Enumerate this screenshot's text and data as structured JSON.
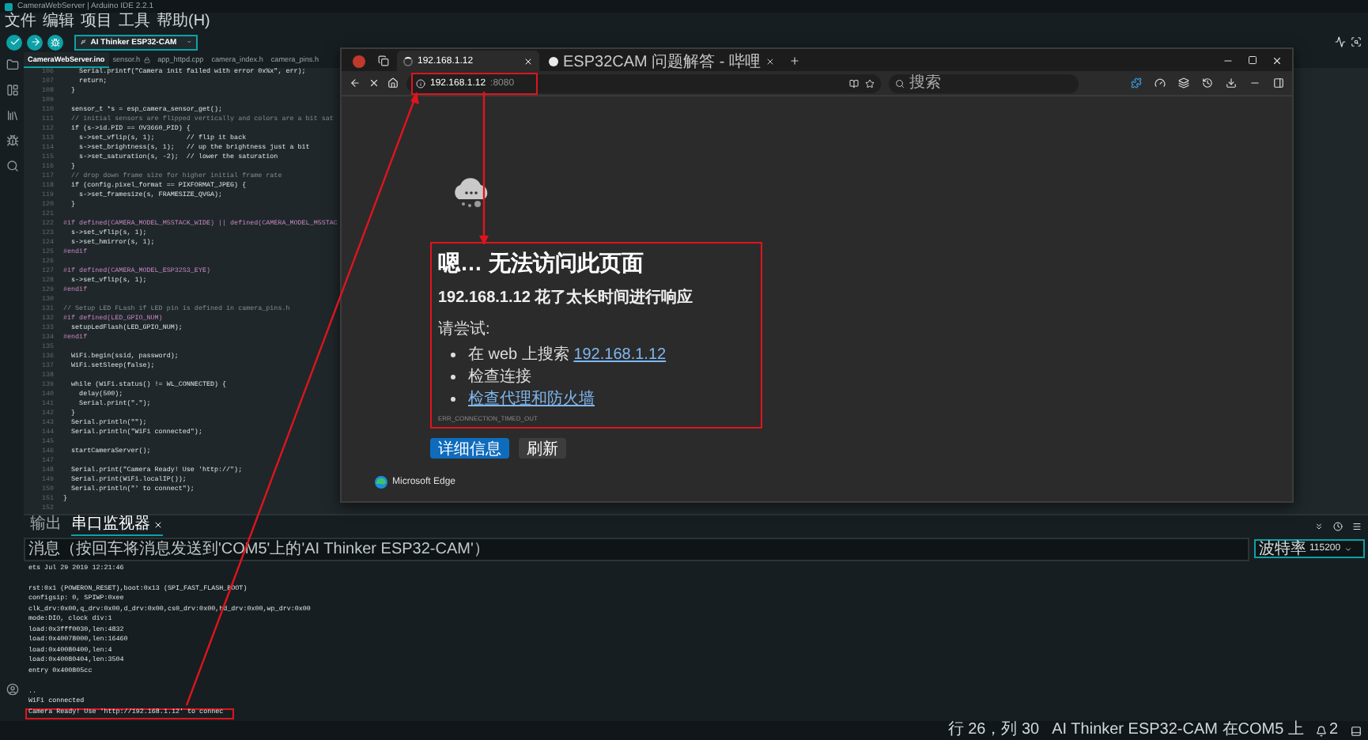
{
  "ide": {
    "title": "CameraWebServer | Arduino IDE 2.2.1",
    "menu": [
      "文件",
      "编辑",
      "项目",
      "工具",
      "帮助(H)"
    ],
    "board": "AI Thinker ESP32-CAM",
    "file_tabs": [
      {
        "label": "CameraWebServer.ino",
        "selected": true,
        "locked": false
      },
      {
        "label": "sensor.h",
        "selected": false,
        "locked": true
      },
      {
        "label": "app_httpd.cpp",
        "selected": false,
        "locked": false
      },
      {
        "label": "camera_index.h",
        "selected": false,
        "locked": false
      },
      {
        "label": "camera_pins.h",
        "selected": false,
        "locked": false
      }
    ],
    "code_lines": [
      {
        "number": "106",
        "kind": "code",
        "text": "    Serial.printf(\"Camera init failed with error 0x%x\", err);"
      },
      {
        "number": "107",
        "kind": "code",
        "text": "    return;"
      },
      {
        "number": "108",
        "kind": "code",
        "text": "  }"
      },
      {
        "number": "109"
      },
      {
        "number": "110",
        "kind": "code",
        "text": "  sensor_t *s = esp_camera_sensor_get();"
      },
      {
        "number": "111",
        "kind": "comment",
        "text": "  // initial sensors are flipped vertically and colors are a bit sat"
      },
      {
        "number": "112",
        "kind": "code",
        "text": "  if (s->id.PID == OV3660_PID) {"
      },
      {
        "number": "113",
        "kind": "code",
        "text": "    s->set_vflip(s, 1);        // flip it back"
      },
      {
        "number": "114",
        "kind": "code",
        "text": "    s->set_brightness(s, 1);   // up the brightness just a bit"
      },
      {
        "number": "115",
        "kind": "code",
        "text": "    s->set_saturation(s, -2);  // lower the saturation"
      },
      {
        "number": "116",
        "kind": "code",
        "text": "  }"
      },
      {
        "number": "117",
        "kind": "comment",
        "text": "  // drop down frame size for higher initial frame rate"
      },
      {
        "number": "118",
        "kind": "code",
        "text": "  if (config.pixel_format == PIXFORMAT_JPEG) {"
      },
      {
        "number": "119",
        "kind": "code",
        "text": "    s->set_framesize(s, FRAMESIZE_QVGA);"
      },
      {
        "number": "120",
        "kind": "code",
        "text": "  }"
      },
      {
        "number": "121"
      },
      {
        "number": "122",
        "kind": "directive",
        "text": "#if defined(CAMERA_MODEL_M5STACK_WIDE) || defined(CAMERA_MODEL_M5STAC"
      },
      {
        "number": "123",
        "kind": "code",
        "text": "  s->set_vflip(s, 1);"
      },
      {
        "number": "124",
        "kind": "code",
        "text": "  s->set_hmirror(s, 1);"
      },
      {
        "number": "125",
        "kind": "directive",
        "text": "#endif"
      },
      {
        "number": "126"
      },
      {
        "number": "127",
        "kind": "directive",
        "text": "#if defined(CAMERA_MODEL_ESP32S3_EYE)"
      },
      {
        "number": "128",
        "kind": "code",
        "text": "  s->set_vflip(s, 1);"
      },
      {
        "number": "129",
        "kind": "directive",
        "text": "#endif"
      },
      {
        "number": "130"
      },
      {
        "number": "131",
        "kind": "comment",
        "text": "// Setup LED FLash if LED pin is defined in camera_pins.h"
      },
      {
        "number": "132",
        "kind": "directive",
        "text": "#if defined(LED_GPIO_NUM)"
      },
      {
        "number": "133",
        "kind": "code",
        "text": "  setupLedFlash(LED_GPIO_NUM);"
      },
      {
        "number": "134",
        "kind": "directive",
        "text": "#endif"
      },
      {
        "number": "135"
      },
      {
        "number": "136",
        "kind": "code",
        "text": "  WiFi.begin(ssid, password);"
      },
      {
        "number": "137",
        "kind": "code",
        "text": "  WiFi.setSleep(false);"
      },
      {
        "number": "138"
      },
      {
        "number": "139",
        "kind": "code",
        "text": "  while (WiFi.status() != WL_CONNECTED) {"
      },
      {
        "number": "140",
        "kind": "code",
        "text": "    delay(500);"
      },
      {
        "number": "141",
        "kind": "code",
        "text": "    Serial.print(\".\");"
      },
      {
        "number": "142",
        "kind": "code",
        "text": "  }"
      },
      {
        "number": "143",
        "kind": "code",
        "text": "  Serial.println(\"\");"
      },
      {
        "number": "144",
        "kind": "code",
        "text": "  Serial.println(\"WiFi connected\");"
      },
      {
        "number": "145"
      },
      {
        "number": "146",
        "kind": "code",
        "text": "  startCameraServer();"
      },
      {
        "number": "147"
      },
      {
        "number": "148",
        "kind": "code",
        "text": "  Serial.print(\"Camera Ready! Use 'http://\");"
      },
      {
        "number": "149",
        "kind": "code",
        "text": "  Serial.print(WiFi.localIP());"
      },
      {
        "number": "150",
        "kind": "code",
        "text": "  Serial.println(\"' to connect\");"
      },
      {
        "number": "151",
        "kind": "code",
        "text": "}"
      },
      {
        "number": "152"
      }
    ],
    "panel_tabs": [
      {
        "label": "输出",
        "selected": false,
        "closable": false
      },
      {
        "label": "串口监视器",
        "selected": true,
        "closable": true
      }
    ],
    "message_field": {
      "placeholder": "消息（按回车将消息发送到'COM5'上的'AI Thinker ESP32-CAM'）"
    },
    "baud": {
      "label": "波特率",
      "value": "115200"
    },
    "serial_lines": [
      {
        "text": "ets Jul 29 2019 12:21:46",
        "highlighted": false
      },
      {
        "highlighted": false
      },
      {
        "text": "rst:0x1 (POWERON_RESET),boot:0x13 (SPI_FAST_FLASH_BOOT)",
        "highlighted": false
      },
      {
        "text": "configsip: 0, SPIWP:0xee",
        "highlighted": false
      },
      {
        "text": "clk_drv:0x00,q_drv:0x00,d_drv:0x00,cs0_drv:0x00,hd_drv:0x00,wp_drv:0x00",
        "highlighted": false
      },
      {
        "text": "mode:DIO, clock div:1",
        "highlighted": false
      },
      {
        "text": "load:0x3fff0030,len:4832",
        "highlighted": false
      },
      {
        "text": "load:0x40078000,len:16460",
        "highlighted": false
      },
      {
        "text": "load:0x40080400,len:4",
        "highlighted": false
      },
      {
        "text": "load:0x40080404,len:3504",
        "highlighted": false
      },
      {
        "text": "entry 0x400805cc",
        "highlighted": false
      },
      {
        "highlighted": false
      },
      {
        "text": "..",
        "highlighted": false
      },
      {
        "text": "WiFi connected",
        "highlighted": false
      },
      {
        "text": "Camera Ready! Use 'http://192.168.1.12' to connec",
        "highlighted": true
      }
    ],
    "status_bar": {
      "position": "行 26，列 30",
      "board": "AI Thinker ESP32-CAM 在COM5 上",
      "notifications": "2"
    }
  },
  "browser": {
    "tabs": [
      {
        "title": "192.168.1.12",
        "selected": true,
        "loading": true
      },
      {
        "title": "ESP32CAM 问题解答 - 哔哩",
        "selected": false,
        "loading": false
      }
    ],
    "address": {
      "host": "192.168.1.12",
      "port": ":8080",
      "highlighted": true
    },
    "search": {
      "placeholder": "搜索"
    },
    "error": {
      "heading": "嗯… 无法访问此页面",
      "message": "192.168.1.12 花了太长时间进行响应",
      "try_label": "请尝试:",
      "suggestions": [
        {
          "text": "在 web 上搜索 ",
          "link": "192.168.1.12"
        },
        {
          "text": "检查连接"
        },
        {
          "link": "检查代理和防火墙"
        }
      ],
      "code": "ERR_CONNECTION_TIMED_OUT",
      "highlighted": true
    },
    "buttons": [
      {
        "label": "详细信息",
        "kind": "primary"
      },
      {
        "label": "刷新",
        "kind": "secondary"
      }
    ],
    "footer": "Microsoft Edge"
  }
}
